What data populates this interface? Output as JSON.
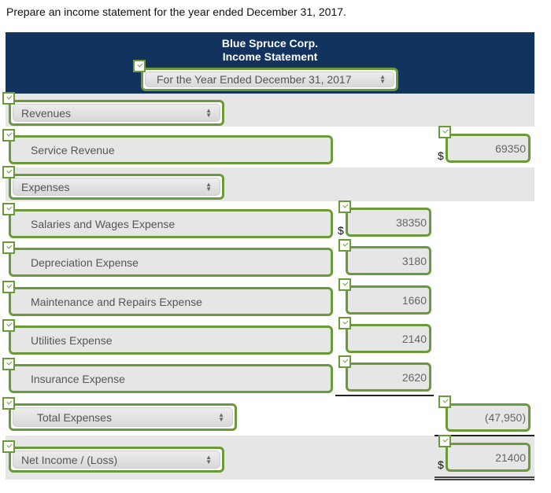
{
  "prompt": "Prepare an income statement for the year ended December 31, 2017.",
  "header": {
    "company": "Blue Spruce Corp.",
    "statement": "Income Statement",
    "period_select": "For the Year Ended December 31, 2017"
  },
  "rows": {
    "revenues_select": "Revenues",
    "service_revenue": {
      "label": "Service Revenue",
      "currency": "$",
      "amount": "69350"
    },
    "expenses_select": "Expenses",
    "expenses": [
      {
        "label": "Salaries and Wages Expense",
        "currency": "$",
        "amount": "38350"
      },
      {
        "label": "Depreciation Expense",
        "currency": "",
        "amount": "3180"
      },
      {
        "label": "Maintenance and Repairs Expense",
        "currency": "",
        "amount": "1660"
      },
      {
        "label": "Utilities Expense",
        "currency": "",
        "amount": "2140"
      },
      {
        "label": "Insurance Expense",
        "currency": "",
        "amount": "2620"
      }
    ],
    "total_expenses": {
      "label": "Total Expenses",
      "amount": "(47,950)"
    },
    "net_income": {
      "label": "Net Income / (Loss)",
      "currency": "$",
      "amount": "21400"
    }
  },
  "status": {
    "all_checks": "correct"
  },
  "colors": {
    "header_bg": "#13335f",
    "check_green": "#6a9a3a",
    "row_grey": "#e6e6e6"
  }
}
